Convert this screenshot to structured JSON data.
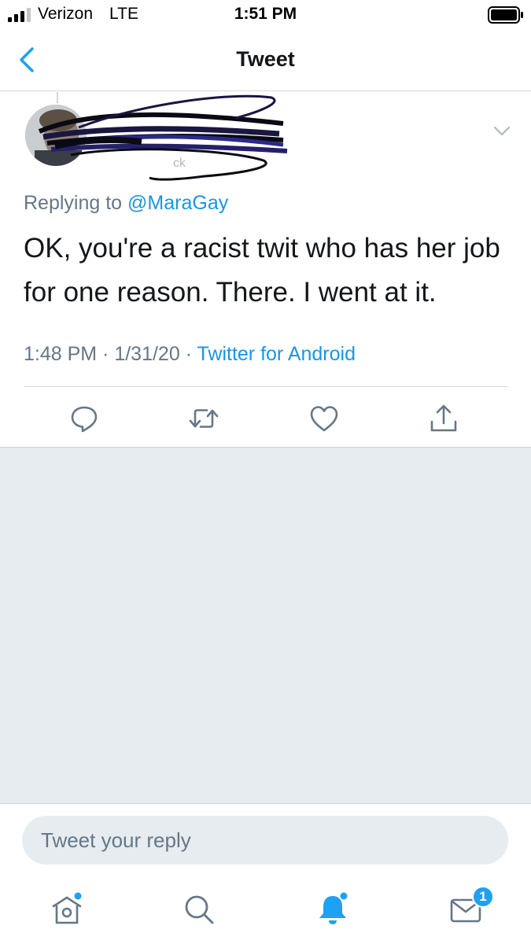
{
  "status_bar": {
    "carrier": "Verizon",
    "network": "LTE",
    "time": "1:51 PM"
  },
  "header": {
    "title": "Tweet"
  },
  "tweet": {
    "replying_prefix": "Replying to ",
    "replying_to": "@MaraGay",
    "text": "OK, you're a racist twit who has her job for one reason. There. I went at it.",
    "time": "1:48 PM",
    "separator": " · ",
    "date": "1/31/20",
    "source": "Twitter for Android"
  },
  "reply": {
    "placeholder": "Tweet your reply"
  },
  "tab_bar": {
    "messages_badge": "1"
  },
  "colors": {
    "accent": "#1da1f2",
    "link": "#1b95e0",
    "muted": "#657786",
    "background_gray": "#e6ecf0"
  },
  "icons": [
    "back-arrow-icon",
    "chevron-down-icon",
    "reply-icon",
    "retweet-icon",
    "like-icon",
    "share-icon",
    "home-icon",
    "search-icon",
    "notifications-icon",
    "messages-icon"
  ]
}
